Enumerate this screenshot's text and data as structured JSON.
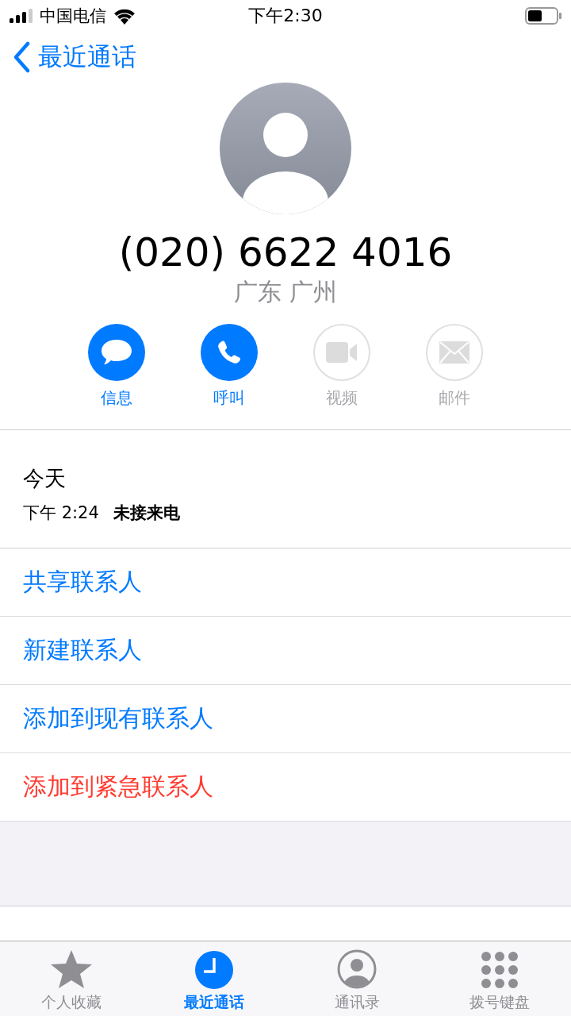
{
  "status_bar": {
    "carrier": "中国电信",
    "time": "下午2:30"
  },
  "nav": {
    "back_label": "最近通话"
  },
  "contact": {
    "number": "(020) 6622 4016",
    "location": "广东 广州"
  },
  "actions": [
    {
      "kind": "message",
      "label": "信息",
      "disabled": false
    },
    {
      "kind": "call",
      "label": "呼叫",
      "disabled": false
    },
    {
      "kind": "video",
      "label": "视频",
      "disabled": true
    },
    {
      "kind": "mail",
      "label": "邮件",
      "disabled": true
    }
  ],
  "call_log": {
    "day": "今天",
    "time": "下午 2:24",
    "type": "未接来电"
  },
  "options": [
    {
      "label": "共享联系人",
      "destructive": false
    },
    {
      "label": "新建联系人",
      "destructive": false
    },
    {
      "label": "添加到现有联系人",
      "destructive": false
    },
    {
      "label": "添加到紧急联系人",
      "destructive": true
    }
  ],
  "tabs": [
    {
      "kind": "favorites",
      "label": "个人收藏",
      "selected": false
    },
    {
      "kind": "recents",
      "label": "最近通话",
      "selected": true
    },
    {
      "kind": "contacts",
      "label": "通讯录",
      "selected": false
    },
    {
      "kind": "keypad",
      "label": "拨号键盘",
      "selected": false
    }
  ]
}
